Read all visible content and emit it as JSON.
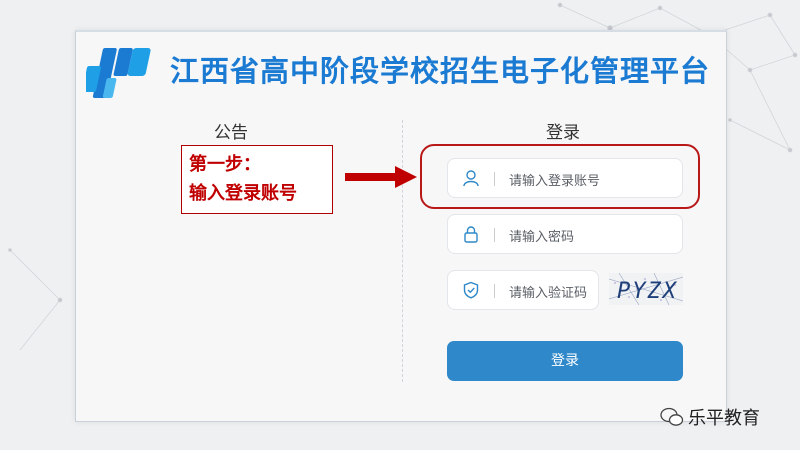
{
  "header": {
    "title": "江西省高中阶段学校招生电子化管理平台"
  },
  "notice": {
    "title": "公告"
  },
  "login": {
    "title": "登录",
    "username_placeholder": "请输入登录账号",
    "password_placeholder": "请输入密码",
    "captcha_placeholder": "请输入验证码",
    "captcha_text": "PYZX",
    "submit_label": "登录"
  },
  "annotation": {
    "line1": "第一步：",
    "line2": "输入登录账号"
  },
  "watermark": {
    "text": "乐平教育"
  },
  "colors": {
    "brand": "#1b7ad2",
    "button": "#2f88c9",
    "annotation": "#c00000"
  }
}
